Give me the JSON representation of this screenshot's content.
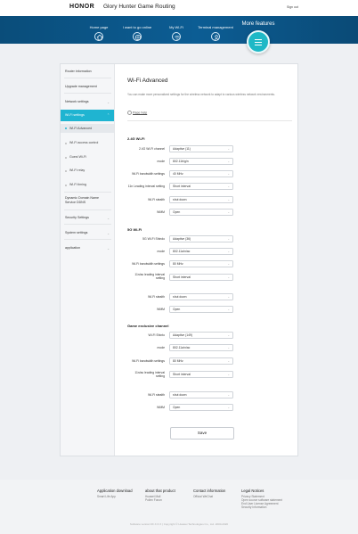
{
  "header": {
    "logo": "HONOR",
    "product_name": "Glory Hunter Game Routing",
    "sign_out": "Sign out"
  },
  "nav": {
    "items": [
      {
        "label": "Home page",
        "icon": "home-icon"
      },
      {
        "label": "I want to go online",
        "icon": "globe-icon"
      },
      {
        "label": "My Wi-Fi",
        "icon": "wifi-icon"
      },
      {
        "label": "Terminal management",
        "icon": "user-icon"
      }
    ],
    "more_label": "More features",
    "more_icon": "menu-icon"
  },
  "sidebar": {
    "items": [
      {
        "label": "Router information"
      },
      {
        "label": "Upgrade management"
      },
      {
        "label": "Network settings"
      },
      {
        "label": "Wi-Fi settings",
        "active": true
      },
      {
        "label": "Wi-Fi Advanced",
        "sub": true,
        "active": true
      },
      {
        "label": "Wi-Fi access control",
        "sub": true
      },
      {
        "label": "Guest Wi-Fi",
        "sub": true
      },
      {
        "label": "Wi-Fi relay",
        "sub": true
      },
      {
        "label": "Wi-Fi timing",
        "sub": true
      },
      {
        "label": "Dynamic Domain Name Service DDNS"
      },
      {
        "label": "Security Settings"
      },
      {
        "label": "System settings"
      },
      {
        "label": "application"
      }
    ]
  },
  "page": {
    "title": "Wi-Fi Advanced",
    "intro": "You can make more personalized settings for the wireless network to adapt to various wireless network environments.",
    "help": "Page help"
  },
  "sections": [
    {
      "title": "2.4G Wi-Fi",
      "fields": [
        {
          "label": "2.4G Wi-Fi channel",
          "value": "Adaptive (11)"
        },
        {
          "label": "mode",
          "value": "802.11b/g/n"
        },
        {
          "label": "Wi-Fi bandwidth settings",
          "value": "40 MHz"
        },
        {
          "label": "11n Leading interval setting",
          "value": "Short interval"
        },
        {
          "label": "Wi-Fi stealth",
          "value": "shut down"
        },
        {
          "label": "WMM",
          "value": "Open"
        }
      ]
    },
    {
      "title": "5G Wi-Fi",
      "fields": [
        {
          "label": "5G Wi-Fi Shindo",
          "value": "Adaptive (36)"
        },
        {
          "label": "mode",
          "value": "802.11a/n/ac"
        },
        {
          "label": "Wi-Fi bandwidth settings",
          "value": "80 MHz"
        },
        {
          "label": "11n/ac leading interval setting",
          "value": "Short interval"
        },
        {
          "label": "Wi-Fi stealth",
          "value": "shut down"
        },
        {
          "label": "WMM",
          "value": "Open"
        }
      ]
    },
    {
      "title": "Game exclusive channel",
      "fields": [
        {
          "label": "Wi-Fi Shinto",
          "value": "Adaptive (149)"
        },
        {
          "label": "mode",
          "value": "802.11a/n/ac"
        },
        {
          "label": "Wi-Fi bandwidth settings",
          "value": "80 MHz"
        },
        {
          "label": "11n/ac leading interval setting",
          "value": "Short interval"
        },
        {
          "label": "Wi-Fi stealth",
          "value": "shut down"
        },
        {
          "label": "WMM",
          "value": "Open"
        }
      ]
    }
  ],
  "save_label": "Save",
  "footer": {
    "columns": [
      {
        "title": "Application download",
        "links": [
          "Smart Life App"
        ]
      },
      {
        "title": "about that product",
        "links": [
          "Huawei Mall",
          "Pollen Forum"
        ]
      },
      {
        "title": "Contact information",
        "links": [
          "Official WeChat"
        ]
      },
      {
        "title": "Legal Notices",
        "links": [
          "Privacy Statement",
          "Open source software statement",
          "End User License Agreement",
          "Security Information"
        ]
      }
    ],
    "copyright": "Software version:9X.X.X.X | Copyright © Huawei Technologies Co., Ltd. 2000-2020"
  },
  "colors": {
    "nav_background": "#0c5d94",
    "accent": "#1fb4d1",
    "more_button": "#1fb8c6"
  }
}
